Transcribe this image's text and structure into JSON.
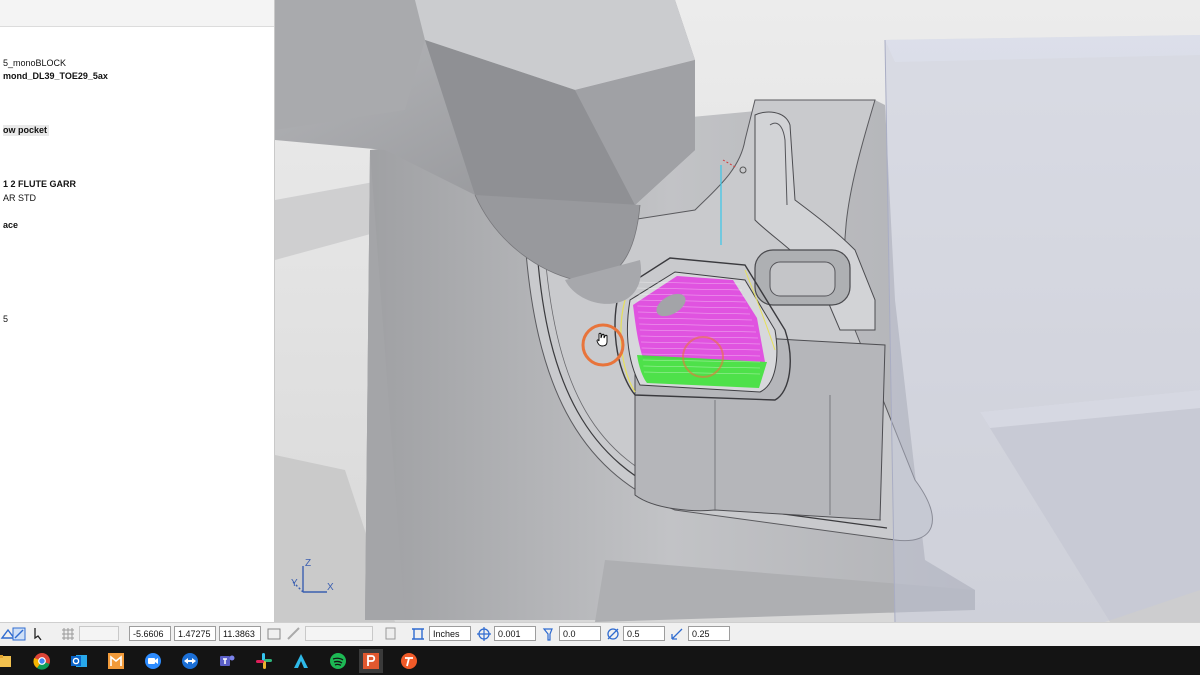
{
  "tree": {
    "lines": [
      {
        "text": "5_monoBLOCK",
        "bold": false,
        "highlight": false
      },
      {
        "text": "mond_DL39_TOE29_5ax",
        "bold": true,
        "highlight": false
      },
      {
        "text": "ow pocket",
        "bold": true,
        "highlight": true
      },
      {
        "text": "1 2 FLUTE GARR",
        "bold": true,
        "highlight": false
      },
      {
        "text": "AR STD",
        "bold": false,
        "highlight": false
      },
      {
        "text": "ace",
        "bold": true,
        "highlight": false
      },
      {
        "text": "5",
        "bold": false,
        "highlight": false
      }
    ]
  },
  "viewport": {
    "triad": {
      "z": "Z",
      "y": "Y",
      "x": "X"
    },
    "colors": {
      "toolpath_magenta": "#e23ce0",
      "toolpath_green": "#3fe23a",
      "highlight_circle": "#e8743b",
      "stock": "#c4c8db"
    }
  },
  "statusbar": {
    "coord_x": "-5.6606",
    "coord_y": "1.47275",
    "coord_z": "11.3863",
    "units": "Inches",
    "tolerance": "0.001",
    "thickness": "0.0",
    "tool_diameter": "0.5",
    "corner_radius": "0.25",
    "icons": [
      "snap-icon",
      "grid-icon",
      "crosshair-icon",
      "tool-icon",
      "diameter-icon",
      "radius-icon"
    ]
  },
  "taskbar": {
    "apps": [
      {
        "name": "file-explorer-icon",
        "color": "#f2c14e"
      },
      {
        "name": "chrome-icon",
        "color": "#db4437"
      },
      {
        "name": "outlook-icon",
        "color": "#0a64c8"
      },
      {
        "name": "powermill-icon",
        "color": "#f29b3a"
      },
      {
        "name": "zoom-icon",
        "color": "#2d8cff"
      },
      {
        "name": "teamviewer-icon",
        "color": "#1b6fd6"
      },
      {
        "name": "teams-icon",
        "color": "#5b5fc7"
      },
      {
        "name": "slack-icon",
        "color": "#e01e5a"
      },
      {
        "name": "autodesk-icon",
        "color": "#2eb9e8"
      },
      {
        "name": "spotify-icon",
        "color": "#1db954"
      },
      {
        "name": "powerpoint-icon",
        "color": "#e0582f"
      },
      {
        "name": "tpass-icon",
        "color": "#f05a28"
      }
    ]
  }
}
